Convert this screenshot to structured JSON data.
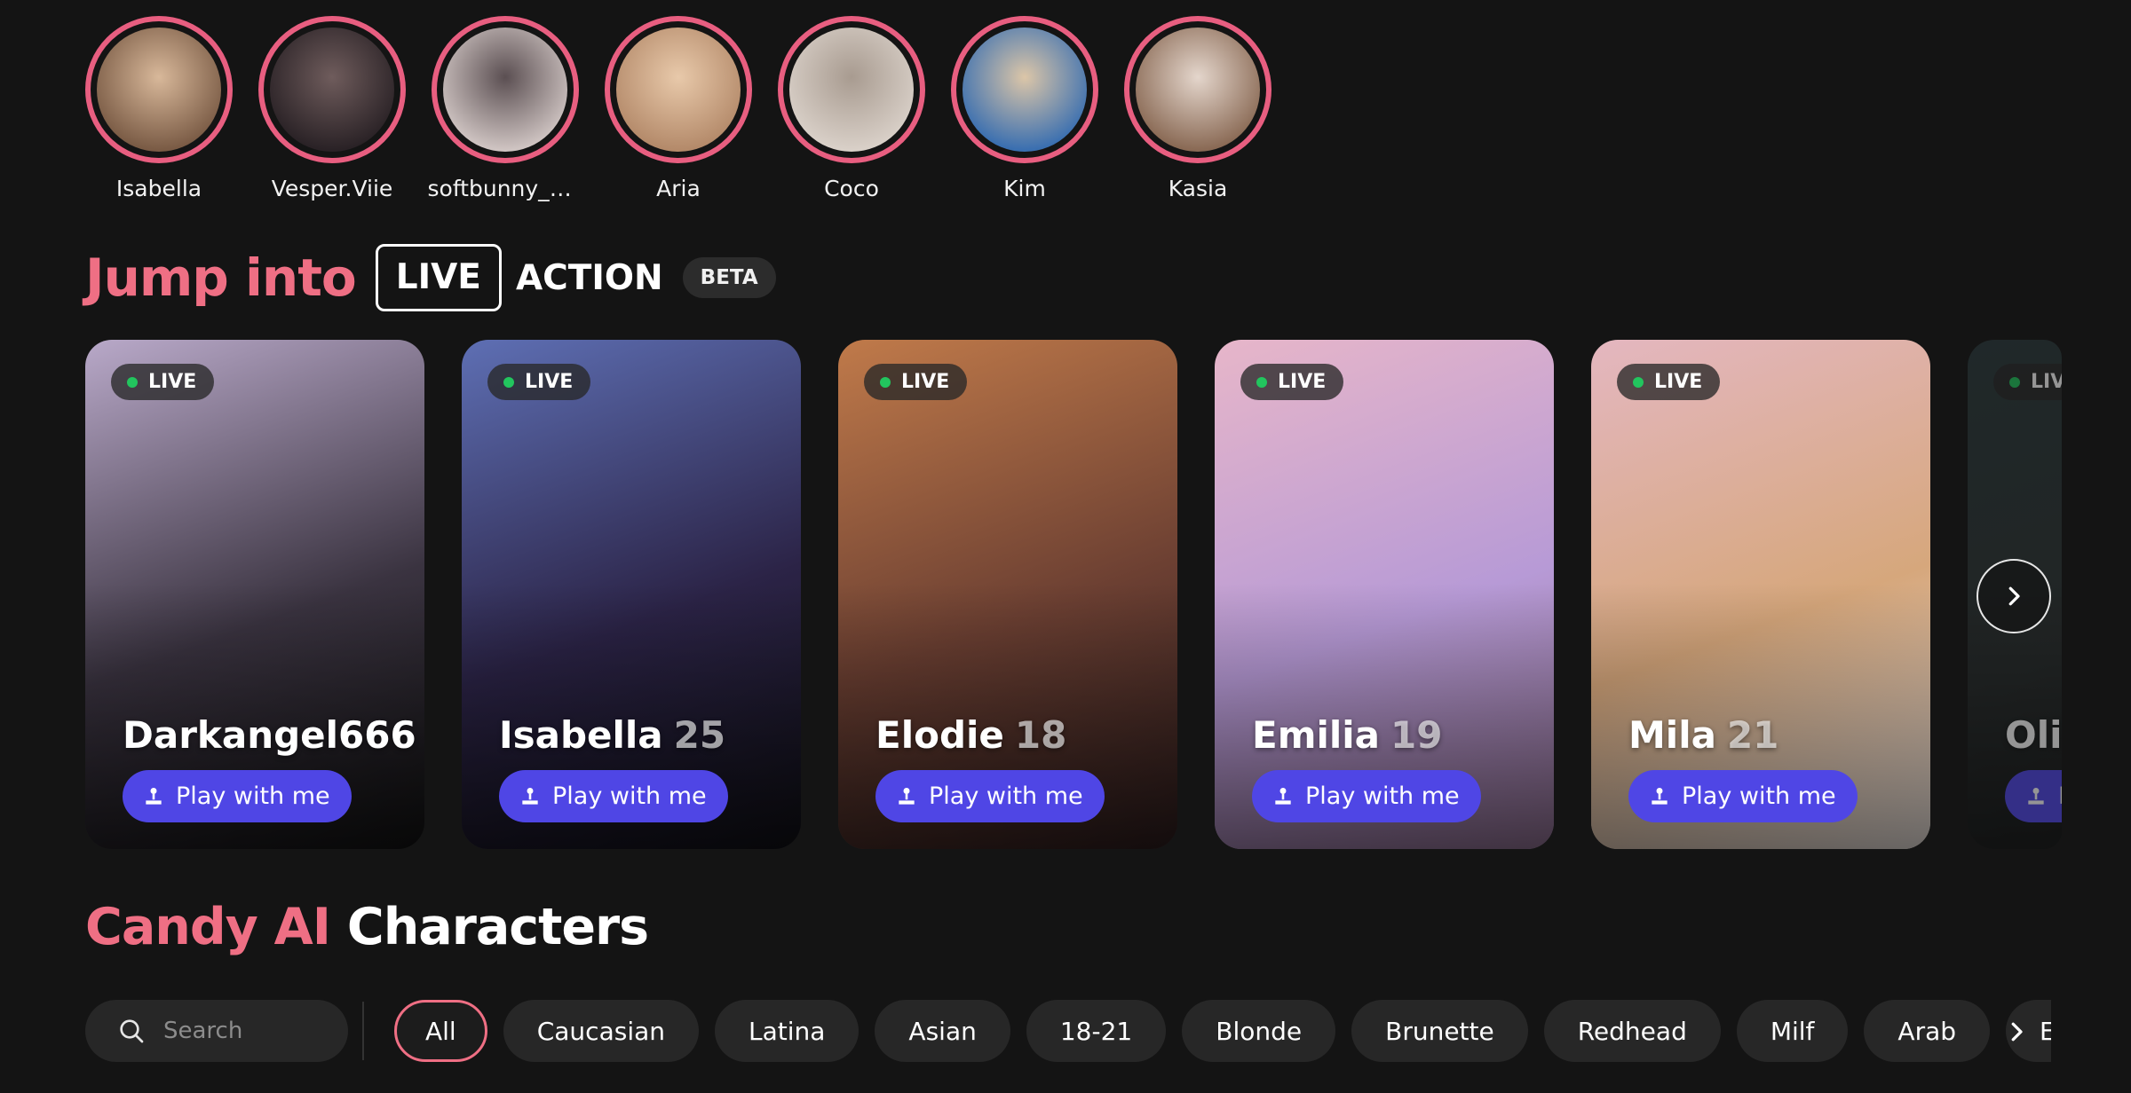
{
  "stories": [
    {
      "name": "Isabella",
      "colors": [
        "#7a5b45",
        "#d8b89a"
      ]
    },
    {
      "name": "Vesper.Viie",
      "colors": [
        "#2a2226",
        "#6f5c5c"
      ]
    },
    {
      "name": "softbunny_x...",
      "colors": [
        "#cfc4c2",
        "#5b4f52"
      ]
    },
    {
      "name": "Aria",
      "colors": [
        "#b48a6a",
        "#e8c9aa"
      ]
    },
    {
      "name": "Coco",
      "colors": [
        "#d9d0c8",
        "#a89b90"
      ]
    },
    {
      "name": "Kim",
      "colors": [
        "#3a6fb0",
        "#dcc6a8"
      ]
    },
    {
      "name": "Kasia",
      "colors": [
        "#8a6a55",
        "#e4d6cc"
      ]
    }
  ],
  "jump": {
    "title": "Jump into",
    "live_label": "LIVE",
    "action_label": "ACTION",
    "beta_label": "BETA"
  },
  "live_badge": "LIVE",
  "play_label": "Play with me",
  "cards": [
    {
      "name": "Darkangel666",
      "age": "",
      "colors": [
        "#b9a9c9",
        "#3a3340",
        "#111"
      ]
    },
    {
      "name": "Isabella",
      "age": "25",
      "colors": [
        "#5e6fb4",
        "#2b2346",
        "#0f0f14"
      ]
    },
    {
      "name": "Elodie",
      "age": "18",
      "colors": [
        "#c07a4a",
        "#6b3f32",
        "#2a1b1c"
      ]
    },
    {
      "name": "Emilia",
      "age": "19",
      "colors": [
        "#e7b6c9",
        "#b79ad6",
        "#8d6f8f"
      ]
    },
    {
      "name": "Mila",
      "age": "21",
      "colors": [
        "#e4b7c0",
        "#d6a77c",
        "#e9e2de"
      ]
    },
    {
      "name": "Oli",
      "age": "",
      "colors": [
        "#2a3a3c",
        "#2d3333",
        "#1a1d1d"
      ]
    }
  ],
  "characters": {
    "title_pink": "Candy AI",
    "title_white": "Characters",
    "search_placeholder": "Search",
    "filters": [
      "All",
      "Caucasian",
      "Latina",
      "Asian",
      "18-21",
      "Blonde",
      "Brunette",
      "Redhead",
      "Milf",
      "Arab",
      "Ebony"
    ],
    "active_filter": "All"
  },
  "accent_color": "#ef6f84",
  "button_color": "#4f46e5",
  "live_dot_color": "#22c55e"
}
